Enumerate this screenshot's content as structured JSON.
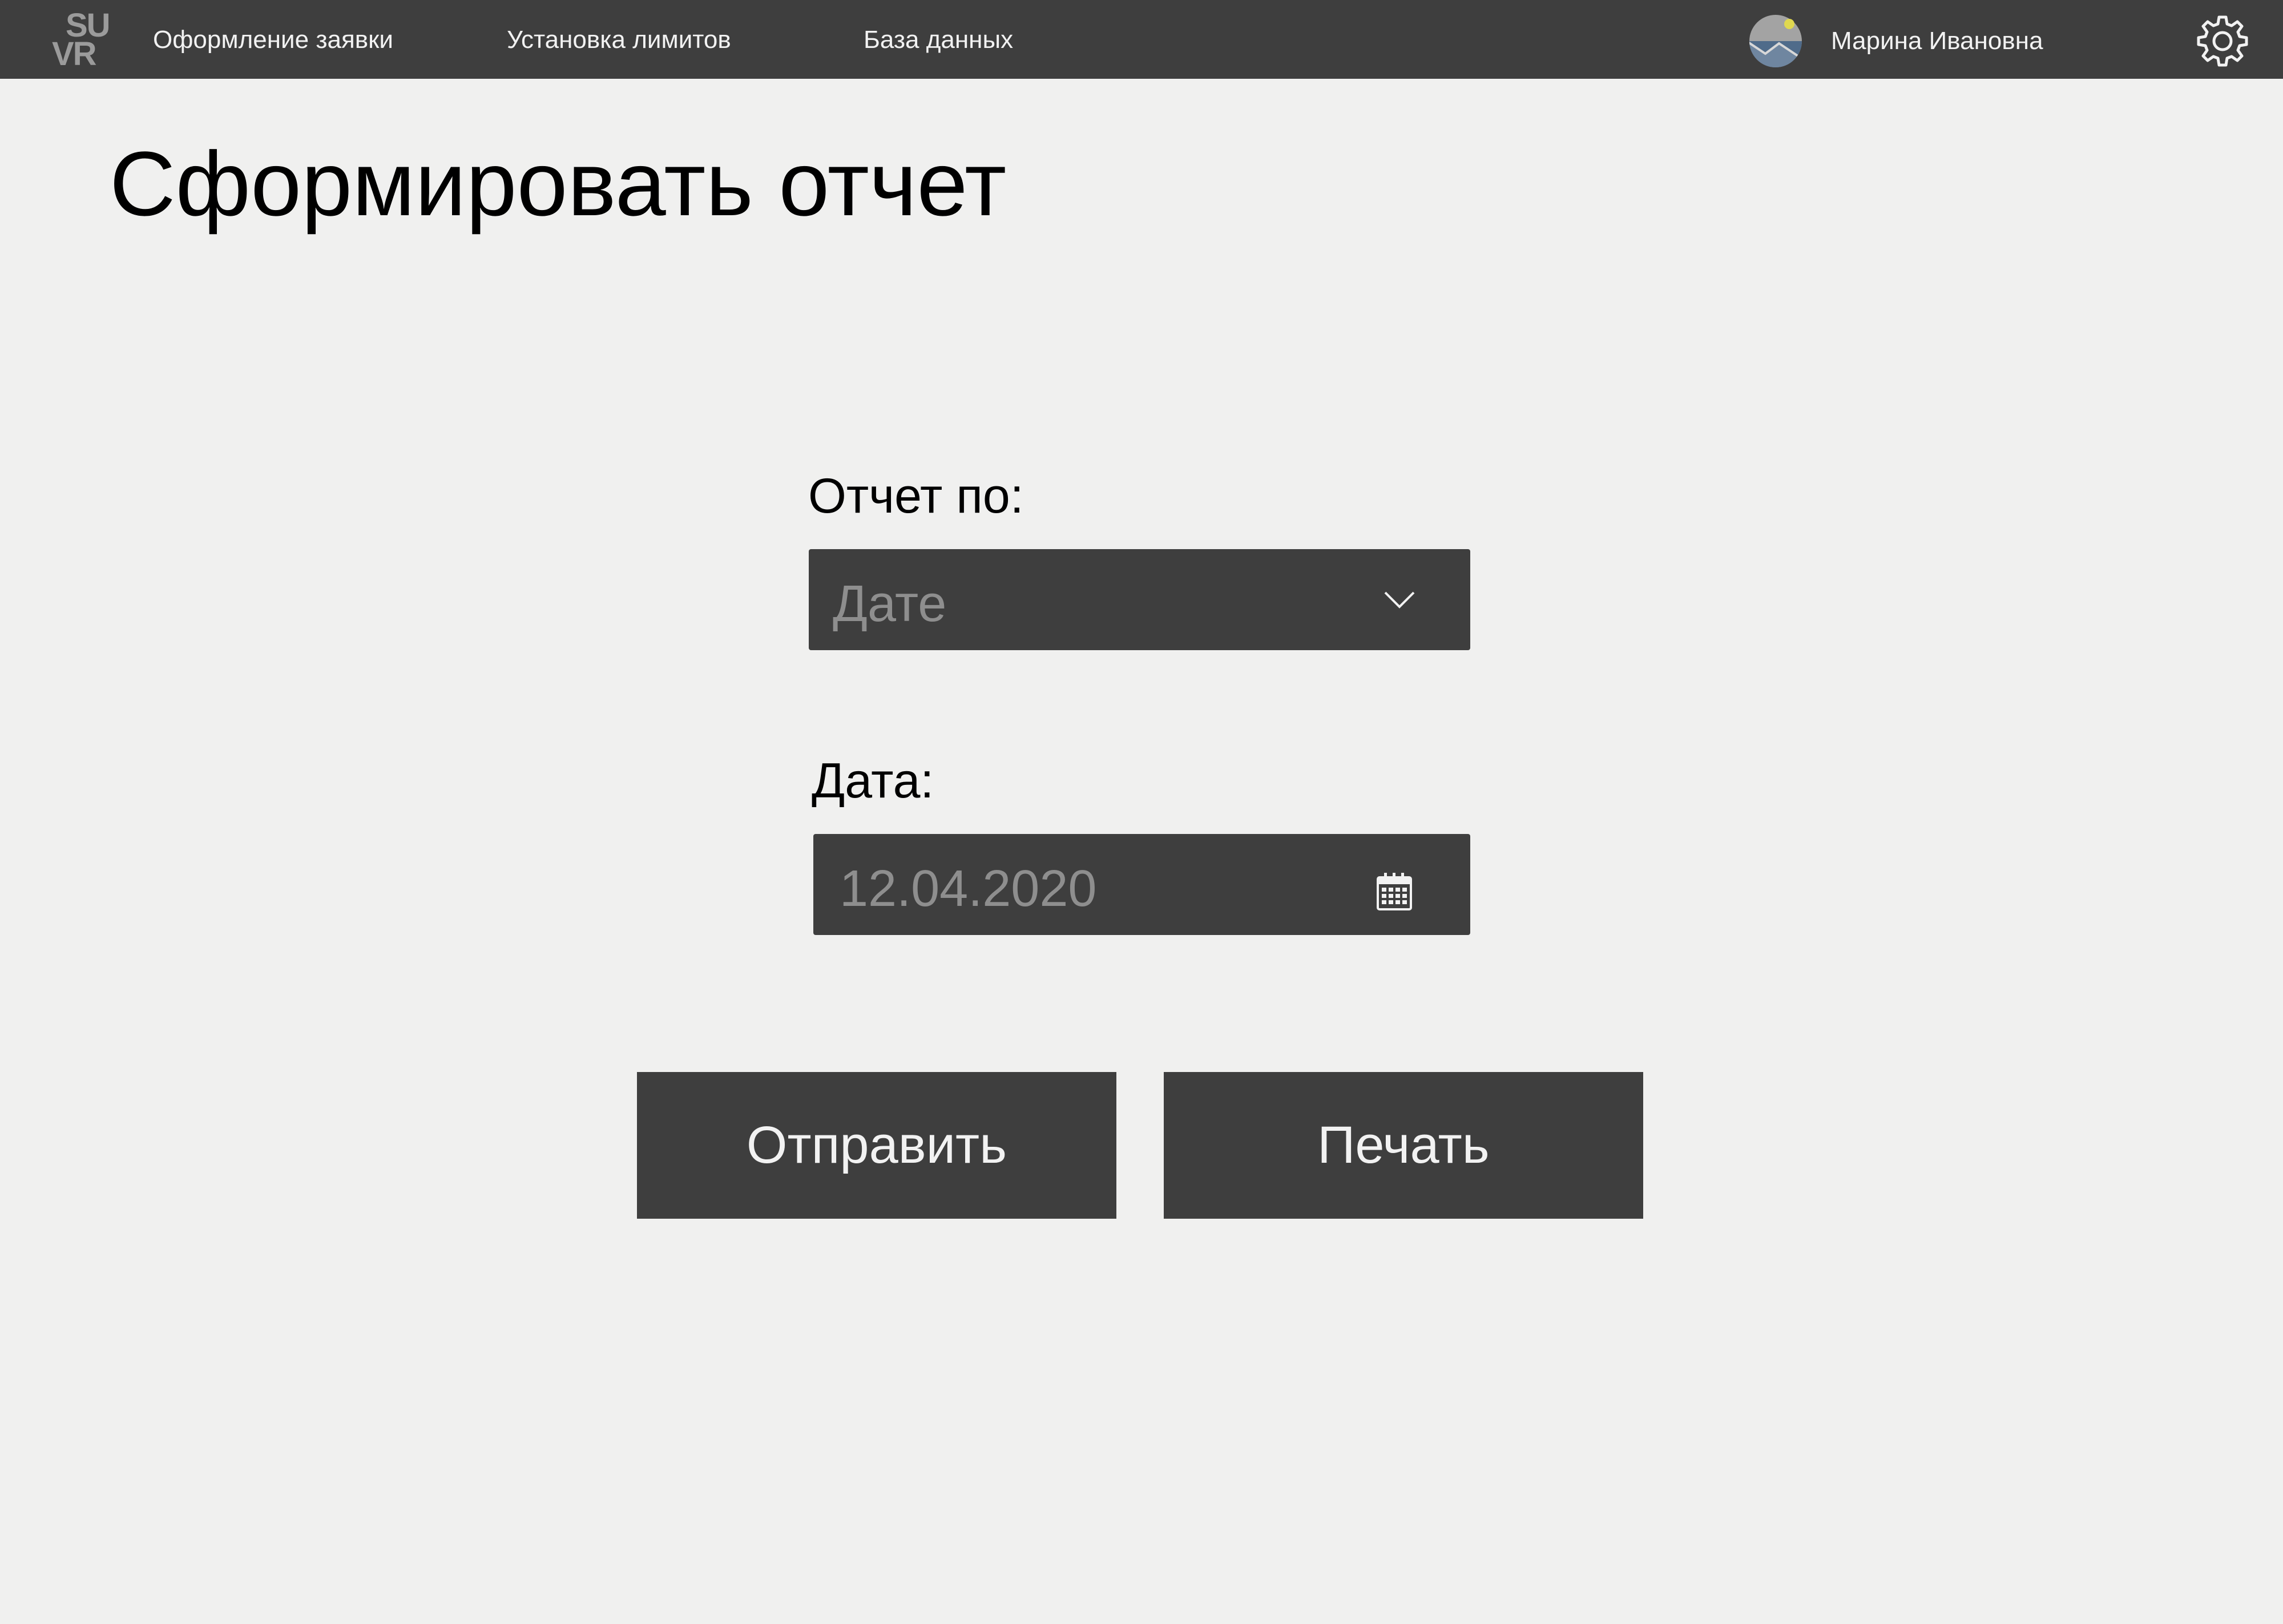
{
  "header": {
    "logo_line1": "SU",
    "logo_line2": "VR",
    "nav": [
      {
        "label": "Оформление заявки"
      },
      {
        "label": "Установка лимитов"
      },
      {
        "label": "База данных"
      }
    ],
    "user_name": "Марина Ивановна",
    "avatar_icon": "avatar-landscape-icon",
    "settings_icon": "gear-icon"
  },
  "main": {
    "title": "Сформировать отчет",
    "report_by": {
      "label": "Отчет по:",
      "value": "Дате",
      "icon": "chevron-down-icon"
    },
    "date": {
      "label": "Дата:",
      "value": "12.04.2020",
      "icon": "calendar-icon"
    },
    "buttons": {
      "send": "Отправить",
      "print": "Печать"
    }
  },
  "colors": {
    "nav_background": "#3e3e3e",
    "page_background": "#f0f0ef",
    "control_background": "#3e3e3e",
    "control_text": "#8e8e8e",
    "button_text": "#f2f2f2",
    "logo": "#9b9b9b"
  }
}
